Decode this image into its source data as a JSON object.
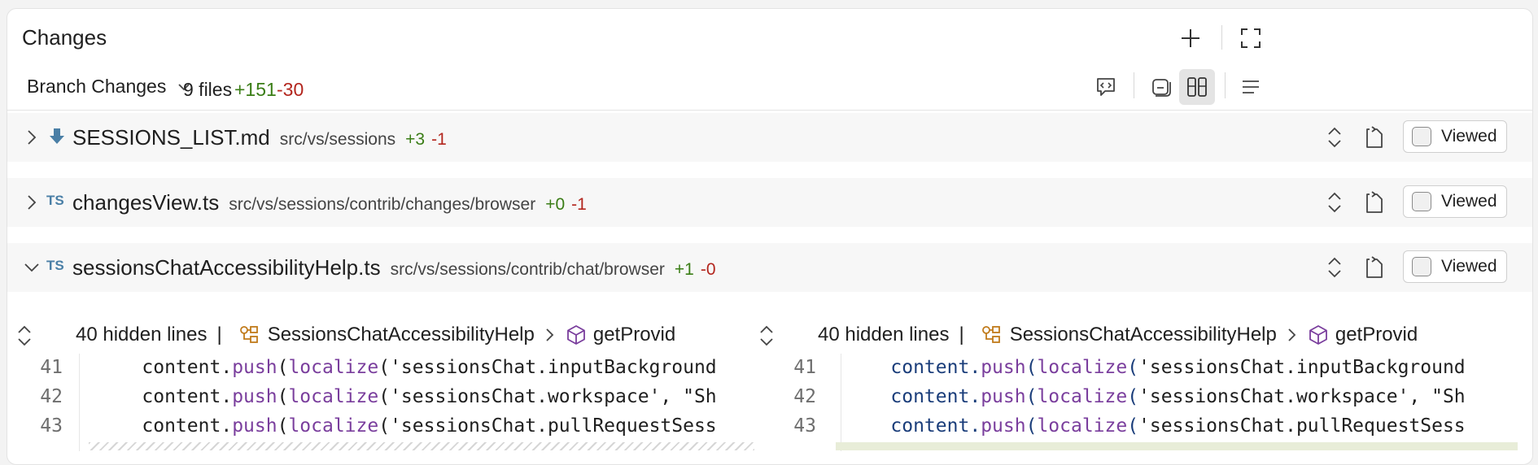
{
  "panel": {
    "title": "Changes"
  },
  "toolbar": {
    "branch_label": "Branch Changes",
    "files_count": "9 files",
    "additions": "+151",
    "deletions": "-30"
  },
  "files": [
    {
      "name": "SESSIONS_LIST.md",
      "path": "src/vs/sessions",
      "additions": "+3",
      "deletions": "-1",
      "icon": "markdown-download-icon",
      "expanded": false,
      "viewed_label": "Viewed"
    },
    {
      "name": "changesView.ts",
      "path": "src/vs/sessions/contrib/changes/browser",
      "additions": "+0",
      "deletions": "-1",
      "icon": "TS",
      "expanded": false,
      "viewed_label": "Viewed"
    },
    {
      "name": "sessionsChatAccessibilityHelp.ts",
      "path": "src/vs/sessions/contrib/chat/browser",
      "additions": "+1",
      "deletions": "-0",
      "icon": "TS",
      "expanded": true,
      "viewed_label": "Viewed"
    }
  ],
  "diff": {
    "left": {
      "hidden_lines": "40 hidden lines",
      "separator": "|",
      "class_name": "SessionsChatAccessibilityHelp",
      "method_name": "getProvid",
      "lines": [
        {
          "num": "41",
          "indent": "    ",
          "obj": "content",
          "dot": ".",
          "push": "push",
          "lp": "(",
          "loc": "localize",
          "lp2": "(",
          "str": "'sessionsChat.inputBackground"
        },
        {
          "num": "42",
          "indent": "    ",
          "obj": "content",
          "dot": ".",
          "push": "push",
          "lp": "(",
          "loc": "localize",
          "lp2": "(",
          "str": "'sessionsChat.workspace', \"Sh"
        },
        {
          "num": "43",
          "indent": "    ",
          "obj": "content",
          "dot": ".",
          "push": "push",
          "lp": "(",
          "loc": "localize",
          "lp2": "(",
          "str": "'sessionsChat.pullRequestSess"
        }
      ]
    },
    "right": {
      "hidden_lines": "40 hidden lines",
      "separator": "|",
      "class_name": "SessionsChatAccessibilityHelp",
      "method_name": "getProvid",
      "lines": [
        {
          "num": "41",
          "indent": "    ",
          "obj": "content",
          "dot": ".",
          "push": "push",
          "lp": "(",
          "loc": "localize",
          "lp2": "(",
          "str": "'sessionsChat.inputBackground"
        },
        {
          "num": "42",
          "indent": "    ",
          "obj": "content",
          "dot": ".",
          "push": "push",
          "lp": "(",
          "loc": "localize",
          "lp2": "(",
          "str": "'sessionsChat.workspace', \"Sh"
        },
        {
          "num": "43",
          "indent": "    ",
          "obj": "content",
          "dot": ".",
          "push": "push",
          "lp": "(",
          "loc": "localize",
          "lp2": "(",
          "str": "'sessionsChat.pullRequestSess"
        }
      ]
    }
  },
  "colors": {
    "additions": "#3a7d16",
    "deletions": "#b3261e",
    "ts_icon": "#4a7fa6",
    "function": "#7a3e9d",
    "string": "#1a1a7e"
  }
}
